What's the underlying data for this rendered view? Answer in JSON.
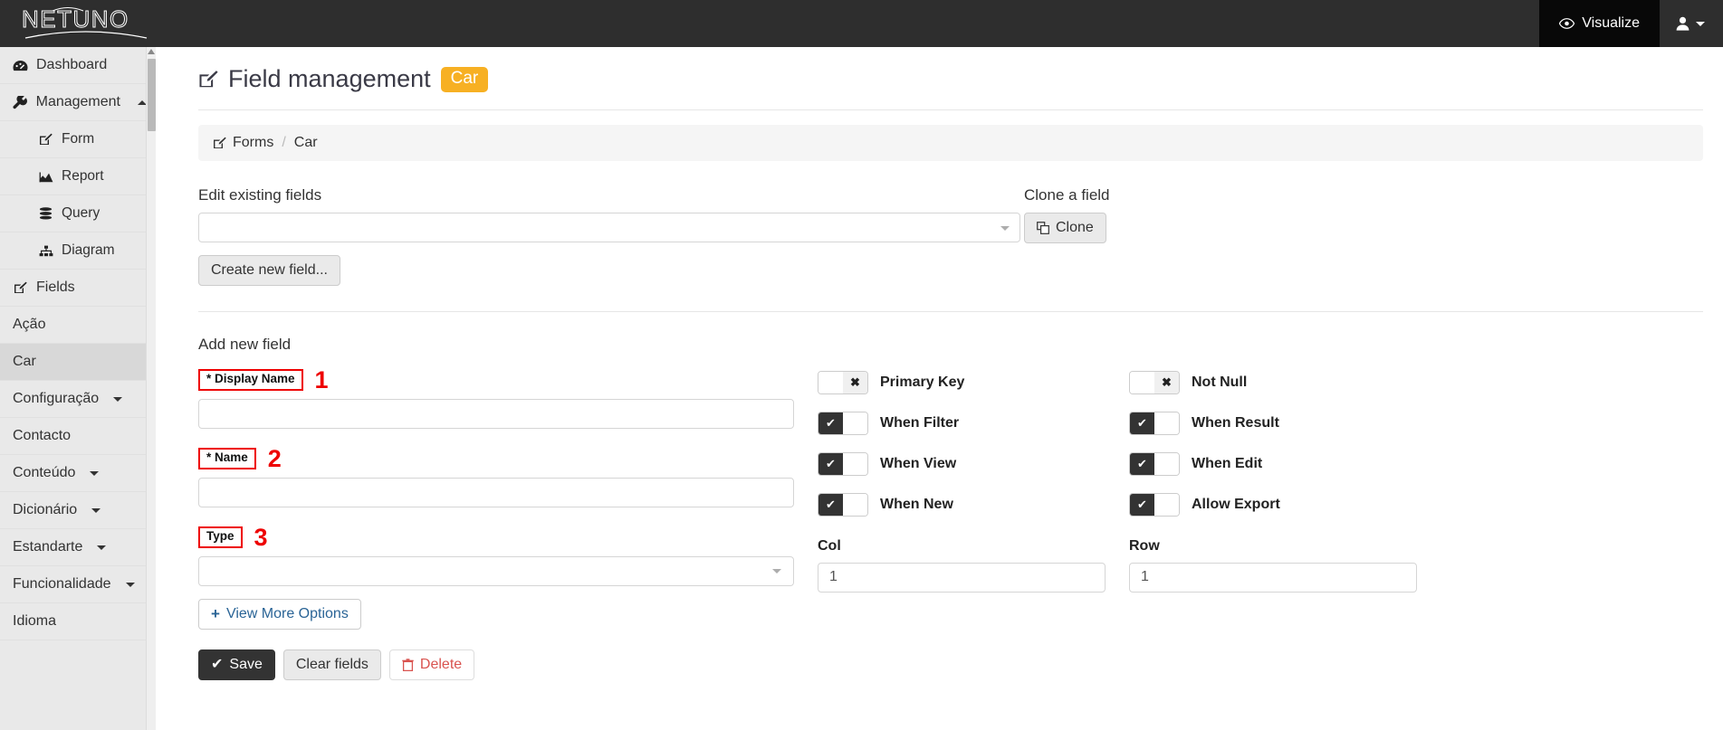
{
  "navbar": {
    "brand": "NETUNO",
    "visualize_label": "Visualize",
    "visualize_icon": "eye-icon",
    "user_icon": "user-icon"
  },
  "sidebar": {
    "items": [
      {
        "label": "Dashboard",
        "icon": "dashboard-icon",
        "level": 0,
        "active": false,
        "caret": ""
      },
      {
        "label": "Management",
        "icon": "wrench-icon",
        "level": 0,
        "active": false,
        "caret": "up"
      },
      {
        "label": "Form",
        "icon": "edit-icon",
        "level": 1,
        "active": false,
        "caret": ""
      },
      {
        "label": "Report",
        "icon": "chart-icon",
        "level": 1,
        "active": false,
        "caret": ""
      },
      {
        "label": "Query",
        "icon": "database-icon",
        "level": 1,
        "active": false,
        "caret": ""
      },
      {
        "label": "Diagram",
        "icon": "sitemap-icon",
        "level": 1,
        "active": false,
        "caret": ""
      },
      {
        "label": "Fields",
        "icon": "edit-icon",
        "level": 0,
        "active": false,
        "caret": ""
      },
      {
        "label": "Ação",
        "icon": "",
        "level": 0,
        "active": false,
        "caret": ""
      },
      {
        "label": "Car",
        "icon": "",
        "level": 0,
        "active": true,
        "caret": ""
      },
      {
        "label": "Configuração",
        "icon": "",
        "level": 0,
        "active": false,
        "caret": "down"
      },
      {
        "label": "Contacto",
        "icon": "",
        "level": 0,
        "active": false,
        "caret": ""
      },
      {
        "label": "Conteúdo",
        "icon": "",
        "level": 0,
        "active": false,
        "caret": "down"
      },
      {
        "label": "Dicionário",
        "icon": "",
        "level": 0,
        "active": false,
        "caret": "down"
      },
      {
        "label": "Estandarte",
        "icon": "",
        "level": 0,
        "active": false,
        "caret": "down"
      },
      {
        "label": "Funcionalidade",
        "icon": "",
        "level": 0,
        "active": false,
        "caret": "down"
      },
      {
        "label": "Idioma",
        "icon": "",
        "level": 0,
        "active": false,
        "caret": ""
      }
    ]
  },
  "page": {
    "title": "Field management",
    "title_icon": "edit-icon",
    "badge": "Car"
  },
  "breadcrumb": {
    "icon": "edit-icon",
    "root": "Forms",
    "separator": "/",
    "current": "Car"
  },
  "edit_existing": {
    "label": "Edit existing fields",
    "select_value": "",
    "create_button": "Create new field..."
  },
  "clone": {
    "label": "Clone a field",
    "button": "Clone",
    "button_icon": "copy-icon"
  },
  "add_new_field": {
    "section_title": "Add new field",
    "fields": [
      {
        "label": "* Display Name",
        "annotation": "1",
        "value": "",
        "name": "display-name"
      },
      {
        "label": "* Name",
        "annotation": "2",
        "value": "",
        "name": "name"
      },
      {
        "label": "Type",
        "annotation": "3",
        "value": "",
        "name": "type"
      }
    ],
    "view_more_options": "View More Options",
    "view_more_icon": "plus-icon"
  },
  "toggles": {
    "left_column": [
      {
        "label": "Primary Key",
        "on": false
      },
      {
        "label": "When Filter",
        "on": true
      },
      {
        "label": "When View",
        "on": true
      },
      {
        "label": "When New",
        "on": true
      }
    ],
    "right_column": [
      {
        "label": "Not Null",
        "on": false
      },
      {
        "label": "When Result",
        "on": true
      },
      {
        "label": "When Edit",
        "on": true
      },
      {
        "label": "Allow Export",
        "on": true
      }
    ],
    "on_glyph": "✔",
    "off_glyph": "✖"
  },
  "position": {
    "col_label": "Col",
    "col_value": "1",
    "row_label": "Row",
    "row_value": "1"
  },
  "footer_actions": {
    "save": "Save",
    "save_icon": "check-icon",
    "clear": "Clear fields",
    "delete": "Delete",
    "delete_icon": "trash-icon"
  },
  "colors": {
    "navbar_bg": "#2e2e2e",
    "badge_orange": "#f7b023",
    "annotation_red": "#ee0000",
    "toggle_on": "#333333",
    "danger": "#d9534f",
    "link_blue": "#2a6496"
  }
}
